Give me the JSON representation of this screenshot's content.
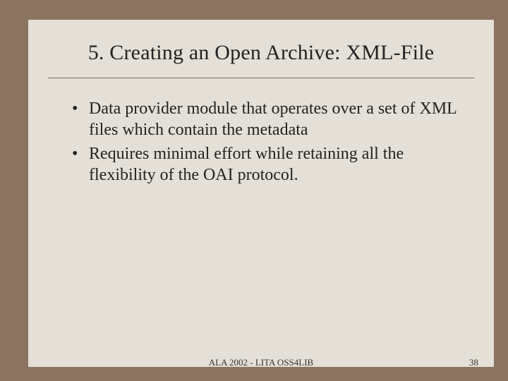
{
  "title": "5. Creating an Open Archive: XML-File",
  "bullets": [
    "Data provider module that operates over a set of XML files which contain the metadata",
    "Requires minimal effort while retaining all the flexibility of the OAI protocol."
  ],
  "footer": {
    "center": "ALA 2002 - LITA OSS4LIB",
    "page": "38"
  }
}
